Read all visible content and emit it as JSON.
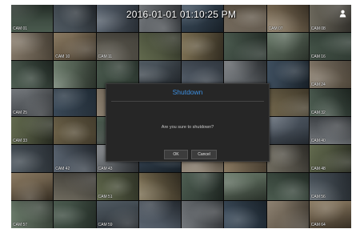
{
  "datetime": "2016-01-01 01:10:25 PM",
  "dialog": {
    "title": "Shutdown",
    "message": "Are you sure to shutdown?",
    "ok_label": "OK",
    "cancel_label": "Cancel"
  },
  "colors": {
    "title_accent": "#3d8fe0",
    "dialog_background": "#262626"
  },
  "icons": {
    "user": "user-icon"
  },
  "camera_labels": [
    "CAM 01",
    "",
    "",
    "",
    "",
    "",
    "CAM 07",
    "CAM 08",
    "",
    "CAM 10",
    "CAM 11",
    "",
    "",
    "",
    "",
    "CAM 16",
    "",
    "",
    "",
    "",
    "",
    "",
    "",
    "CAM 24",
    "CAM 25",
    "",
    "",
    "",
    "",
    "",
    "",
    "CAM 32",
    "CAM 33",
    "",
    "",
    "",
    "",
    "",
    "",
    "CAM 40",
    "",
    "CAM 42",
    "CAM 43",
    "",
    "",
    "",
    "",
    "CAM 48",
    "",
    "",
    "CAM 51",
    "",
    "",
    "",
    "",
    "CAM 56",
    "CAM 57",
    "",
    "CAM 59",
    "",
    "",
    "",
    "",
    "CAM 64"
  ]
}
